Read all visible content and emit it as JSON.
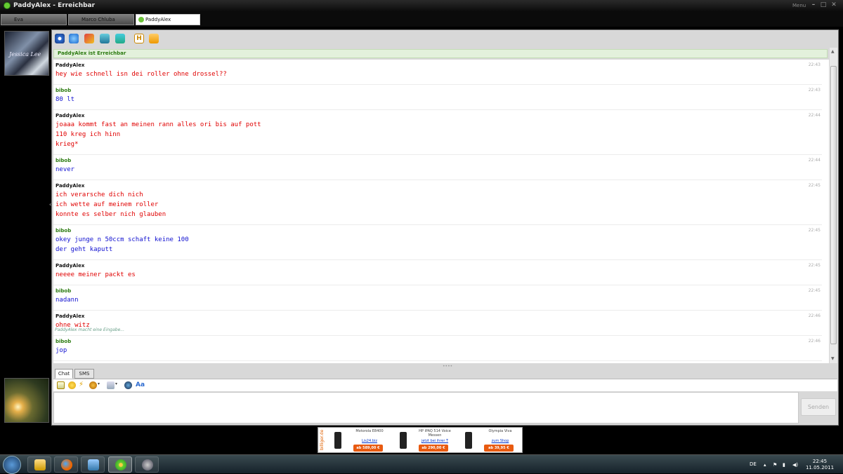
{
  "window": {
    "title": "PaddyAlex - Erreichbar",
    "menu_label": "Menu"
  },
  "contact_tabs": [
    {
      "label": "Eva"
    },
    {
      "label": "Marco Chluba"
    },
    {
      "label": "PaddyAlex",
      "active": true
    }
  ],
  "toolbar": {
    "icons": [
      "webcam-icon",
      "globe-icon",
      "games-icon",
      "files-icon",
      "gamepad-icon",
      "h-icon",
      "card-icon"
    ]
  },
  "status_text": "PaddyAlex ist Erreichbar",
  "messages": [
    {
      "sender": "PaddyAlex",
      "time": "22:43",
      "lines": [
        "hey wie schnell isn dei roller ohne drossel??"
      ]
    },
    {
      "sender": "bibob",
      "time": "22:43",
      "lines": [
        "80 lt"
      ]
    },
    {
      "sender": "PaddyAlex",
      "time": "22:44",
      "lines": [
        "joaaa kommt fast an meinen rann alles ori bis auf pott",
        "110 kreg ich hinn",
        "krieg*"
      ]
    },
    {
      "sender": "bibob",
      "time": "22:44",
      "lines": [
        "never"
      ]
    },
    {
      "sender": "PaddyAlex",
      "time": "22:45",
      "lines": [
        "ich verarsche dich nich",
        "ich wette auf meinem roller",
        "konnte es selber nich glauben"
      ]
    },
    {
      "sender": "bibob",
      "time": "22:45",
      "lines": [
        "okey junge n 50ccm schaft keine 100",
        "der geht kaputt"
      ]
    },
    {
      "sender": "PaddyAlex",
      "time": "22:45",
      "lines": [
        "neeee meiner packt es"
      ]
    },
    {
      "sender": "bibob",
      "time": "22:45",
      "lines": [
        "nadann"
      ]
    },
    {
      "sender": "PaddyAlex",
      "time": "22:46",
      "lines": [
        "ohne witz"
      ]
    },
    {
      "sender": "bibob",
      "time": "22:46",
      "lines": [
        "jop"
      ]
    }
  ],
  "typing_indicator": "PaddyAlex macht eine Eingabe...",
  "input_tabs": [
    {
      "label": "Chat",
      "active": true
    },
    {
      "label": "SMS"
    }
  ],
  "format_icons": [
    "font-icon",
    "smiley-icon",
    "nudge-icon",
    "animation-icon",
    "background-icon",
    "voice-icon",
    "winks-icon"
  ],
  "send_label": "Senden",
  "ad": {
    "brand": "billiger.de",
    "items": [
      {
        "name": "Motorola E8400",
        "link": "Lis24.biz",
        "price": "ab 589,00 €"
      },
      {
        "name": "HP iPAQ 514 Voice Messen",
        "link": "jetzt bei ihrer T",
        "price": "ab 290,00 €"
      },
      {
        "name": "Olympia Viva",
        "link": "zum Shop",
        "price": "ab 39,95 €"
      }
    ]
  },
  "taskbar": {
    "apps": [
      "explorer-icon",
      "firefox-icon",
      "network-icon",
      "icq-icon",
      "steam-icon"
    ],
    "language": "DE",
    "time": "22:45",
    "date": "11.05.2011"
  },
  "colors": {
    "partner_text": "#e00000",
    "self_text": "#1010d0",
    "self_name": "#2b7a10"
  }
}
